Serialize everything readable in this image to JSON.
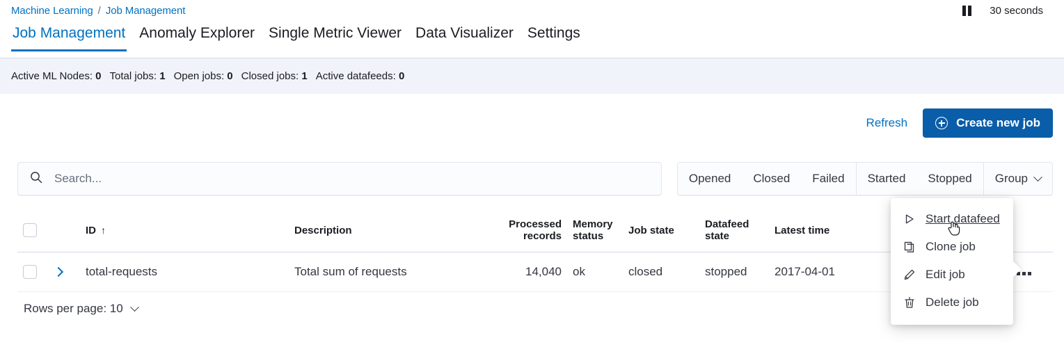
{
  "breadcrumb": {
    "items": [
      "Machine Learning",
      "Job Management"
    ],
    "separator": "/"
  },
  "refresh_status": {
    "pause_icon": "pause-icon",
    "interval": "30 seconds"
  },
  "tabs": [
    {
      "label": "Job Management",
      "active": true
    },
    {
      "label": "Anomaly Explorer",
      "active": false
    },
    {
      "label": "Single Metric Viewer",
      "active": false
    },
    {
      "label": "Data Visualizer",
      "active": false
    },
    {
      "label": "Settings",
      "active": false
    }
  ],
  "stats": [
    {
      "label": "Active ML Nodes:",
      "value": "0"
    },
    {
      "label": "Total jobs:",
      "value": "1"
    },
    {
      "label": "Open jobs:",
      "value": "0"
    },
    {
      "label": "Closed jobs:",
      "value": "1"
    },
    {
      "label": "Active datafeeds:",
      "value": "0"
    }
  ],
  "actions": {
    "refresh_label": "Refresh",
    "create_label": "Create new job",
    "create_icon": "plus-in-circle-icon",
    "accent_color": "#0a5da8"
  },
  "search": {
    "placeholder": "Search...",
    "value": "",
    "icon": "search-icon"
  },
  "filters": {
    "state_buttons": [
      "Opened",
      "Closed",
      "Failed"
    ],
    "datafeed_buttons": [
      "Started",
      "Stopped"
    ],
    "group_label": "Group",
    "group_icon": "chevron-down-icon"
  },
  "table": {
    "columns": [
      {
        "key": "id",
        "label": "ID",
        "sorted": "asc",
        "sort_icon": "arrow-up-icon"
      },
      {
        "key": "description",
        "label": "Description"
      },
      {
        "key": "processed_records",
        "label": "Processed records"
      },
      {
        "key": "memory_status",
        "label": "Memory status"
      },
      {
        "key": "job_state",
        "label": "Job state"
      },
      {
        "key": "datafeed_state",
        "label": "Datafeed state"
      },
      {
        "key": "latest_time",
        "label": "Latest time"
      }
    ],
    "rows": [
      {
        "id": "total-requests",
        "description": "Total sum of requests",
        "processed_records": "14,040",
        "memory_status": "ok",
        "job_state": "closed",
        "datafeed_state": "stopped",
        "latest_time": "2017-04-01",
        "expand_icon": "chevron-right-icon",
        "actions_icon": "ellipsis-horizontal-icon"
      }
    ]
  },
  "footer": {
    "rows_per_page_label": "Rows per page: 10",
    "icon": "chevron-down-icon"
  },
  "context_menu": {
    "items": [
      {
        "label": "Start datafeed",
        "icon": "play-icon",
        "hovered": true
      },
      {
        "label": "Clone job",
        "icon": "copy-icon",
        "hovered": false
      },
      {
        "label": "Edit job",
        "icon": "pencil-icon",
        "hovered": false
      },
      {
        "label": "Delete job",
        "icon": "trash-icon",
        "hovered": false
      }
    ]
  },
  "cursor": {
    "type": "pointer-hand-cursor"
  }
}
